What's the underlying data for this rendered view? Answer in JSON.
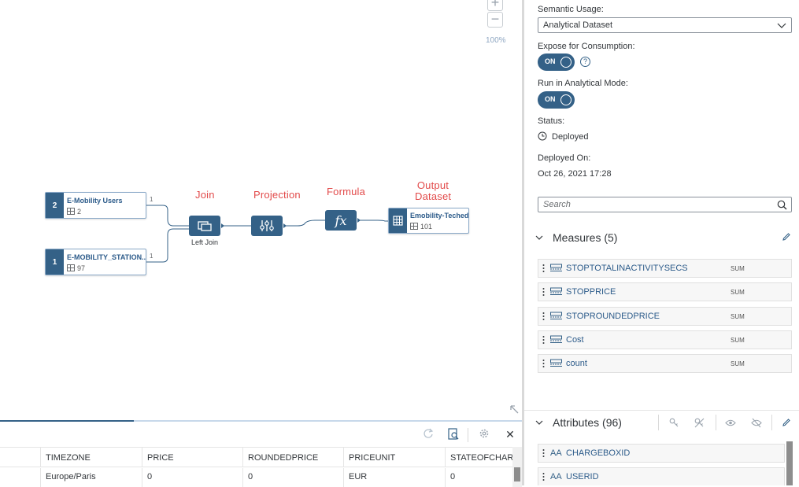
{
  "canvas": {
    "zoom_in": "+",
    "zoom_out": "−",
    "zoom_level": "100%",
    "annotations": {
      "join": "Join",
      "projection": "Projection",
      "formula": "Formula",
      "output_line1": "Output",
      "output_line2": "Dataset"
    },
    "nodes": {
      "users": {
        "badge": "2",
        "title": "E-Mobility Users",
        "count": "2",
        "edge": "1"
      },
      "stations": {
        "badge": "1",
        "title": "E-MOBILITY_STATION...",
        "count": "97",
        "edge": "1"
      },
      "join_label": "Left Join",
      "formula_symbol": "fx",
      "output": {
        "title": "Emobility-Teched",
        "count": "101"
      }
    }
  },
  "bottom": {
    "columns": [
      "TIMEZONE",
      "PRICE",
      "ROUNDEDPRICE",
      "PRICEUNIT",
      "STATEOFCHARG"
    ],
    "row": [
      "Europe/Paris",
      "0",
      "0",
      "EUR",
      "0"
    ],
    "close_label": "✕"
  },
  "panel": {
    "semantic_usage_label": "Semantic Usage:",
    "semantic_usage_value": "Analytical Dataset",
    "expose_label": "Expose for Consumption:",
    "expose_toggle": "ON",
    "help": "?",
    "analytical_label": "Run in Analytical Mode:",
    "analytical_toggle": "ON",
    "status_label": "Status:",
    "status_value": "Deployed",
    "deployed_on_label": "Deployed On:",
    "deployed_on_value": "Oct 26, 2021 17:28",
    "search_placeholder": "Search",
    "measures_title": "Measures (5)",
    "measures": [
      {
        "name": "STOPTOTALINACTIVITYSECS",
        "agg": "SUM"
      },
      {
        "name": "STOPPRICE",
        "agg": "SUM"
      },
      {
        "name": "STOPROUNDEDPRICE",
        "agg": "SUM"
      },
      {
        "name": "Cost",
        "agg": "SUM"
      },
      {
        "name": "count",
        "agg": "SUM"
      }
    ],
    "attributes_title": "Attributes (96)",
    "attributes": [
      {
        "name": "CHARGEBOXID",
        "icon": "AA"
      },
      {
        "name": "USERID",
        "icon": "AA"
      }
    ]
  },
  "colors": {
    "accent": "#346187",
    "annotation": "#e24a4a"
  }
}
